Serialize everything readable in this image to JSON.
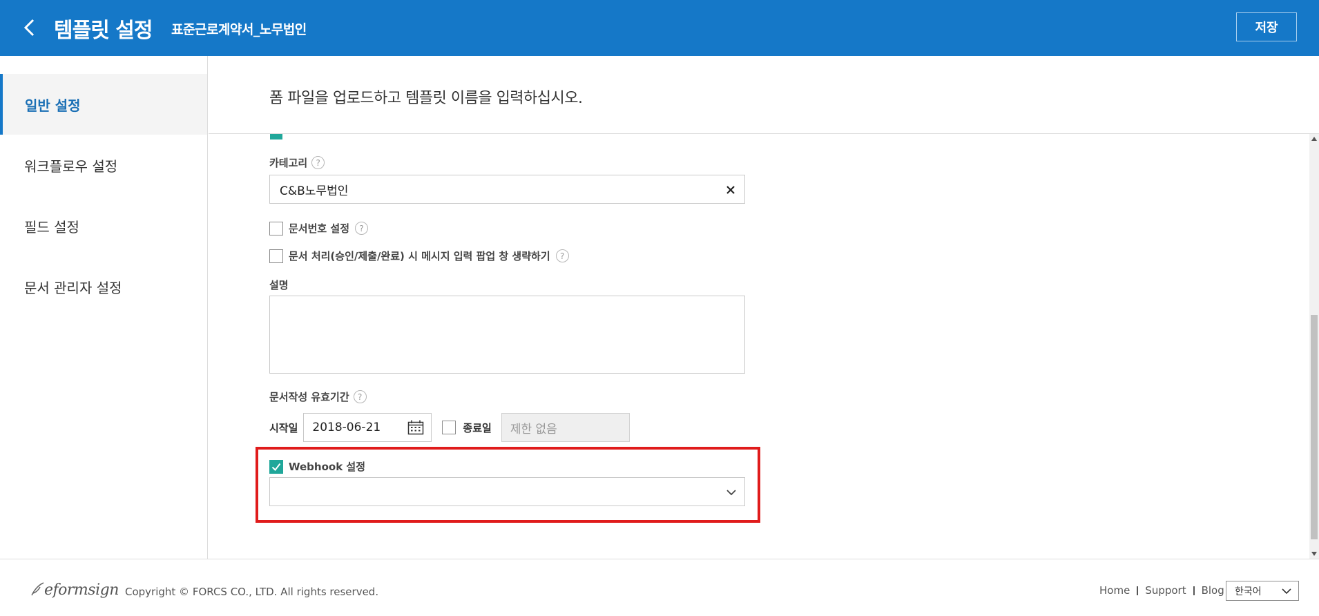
{
  "header": {
    "title": "템플릿 설정",
    "subtitle": "표준근로계약서_노무법인",
    "save_label": "저장",
    "bg_color": "#1578c8"
  },
  "sidebar": {
    "items": [
      {
        "label": "일반 설정",
        "active": true
      },
      {
        "label": "워크플로우 설정",
        "active": false
      },
      {
        "label": "필드 설정",
        "active": false
      },
      {
        "label": "문서 관리자 설정",
        "active": false
      }
    ]
  },
  "main": {
    "instruction": "폼 파일을 업로드하고 템플릿 이름을 입력하십시오.",
    "category": {
      "label": "카테고리",
      "value": "C&B노무법인",
      "help": "?"
    },
    "doc_number": {
      "label": "문서번호 설정",
      "checked": false,
      "help": "?"
    },
    "skip_popup": {
      "label": "문서 처리(승인/제출/완료) 시 메시지 입력 팝업 창 생략하기",
      "checked": false,
      "help": "?"
    },
    "description": {
      "label": "설명",
      "value": ""
    },
    "validity": {
      "label": "문서작성 유효기간",
      "help": "?",
      "start_label": "시작일",
      "start_value": "2018-06-21",
      "end_label": "종료일",
      "end_checked": false,
      "end_placeholder": "제한 없음"
    },
    "webhook": {
      "label": "Webhook 설정",
      "checked": true,
      "selected": ""
    }
  },
  "footer": {
    "logo_text": "eformsign",
    "copyright": "Copyright © FORCS CO., LTD. All rights reserved.",
    "links": [
      "Home",
      "Support",
      "Blog"
    ],
    "language": "한국어"
  },
  "colors": {
    "accent": "#1578c8",
    "checkbox_checked": "#20a79a",
    "highlight": "#e01b1b"
  }
}
